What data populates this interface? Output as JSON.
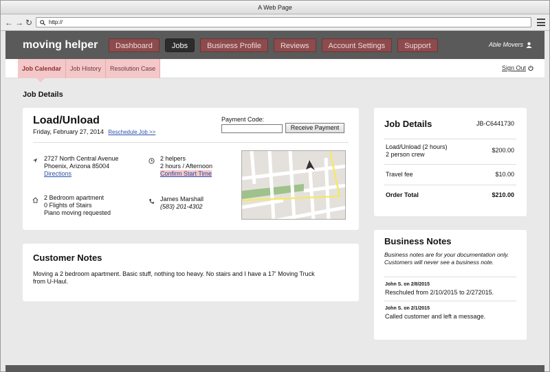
{
  "browser": {
    "title": "A Web Page",
    "url": "http://"
  },
  "app": {
    "logo": "moving helper",
    "nav": [
      "Dashboard",
      "Jobs",
      "Business Profile",
      "Reviews",
      "Account Settings",
      "Support"
    ],
    "active_nav": "Jobs",
    "user": "Able Movers"
  },
  "subnav": {
    "tabs": [
      "Job Calendar",
      "Job History",
      "Resolution Case"
    ],
    "active": "Job Calendar",
    "sign_out": "Sign Out"
  },
  "page_title": "Job Details",
  "job": {
    "title": "Load/Unload",
    "date": "Friday, February 27, 2014",
    "reschedule": "Reschedule Job >>",
    "payment_label": "Payment Code:",
    "payment_value": "",
    "receive_button": "Receive Payment",
    "address_line1": "2727 North Central Avenue",
    "address_line2": "Phoenix, Arizona 85004",
    "directions": "Directions",
    "helpers": "2 helpers",
    "duration": "2 hours / Afternoon",
    "confirm_start": "Confirm Start Time",
    "home_line1": "2 Bedroom apartment",
    "home_line2": "0 Flights of Stairs",
    "home_line3": "Piano moving requested",
    "contact_name": "James Marshall",
    "contact_phone": "(583) 201-4302"
  },
  "customer_notes": {
    "title": "Customer Notes",
    "text": "Moving a 2 bedroom apartment. Basic stuff, nothing too heavy. No stairs and I have a 17' Moving Truck from U-Haul."
  },
  "summary": {
    "title": "Job Details",
    "id": "JB-C6441730",
    "line1_label": "Load/Unload (2 hours)",
    "line1_sub": "2 person crew",
    "line1_amount": "$200.00",
    "line2_label": "Travel fee",
    "line2_amount": "$10.00",
    "total_label": "Order Total",
    "total_amount": "$210.00"
  },
  "business_notes": {
    "title": "Business Notes",
    "disclaimer": "Business notes are for your documentation only. Customers will never see a business note.",
    "entries": [
      {
        "meta": "John S. on 2/8/2015",
        "text": "Reschuled from 2/10/2015 to 2/272015."
      },
      {
        "meta": "John S. on 2/1/2015",
        "text": "Called customer and left a message."
      }
    ]
  }
}
